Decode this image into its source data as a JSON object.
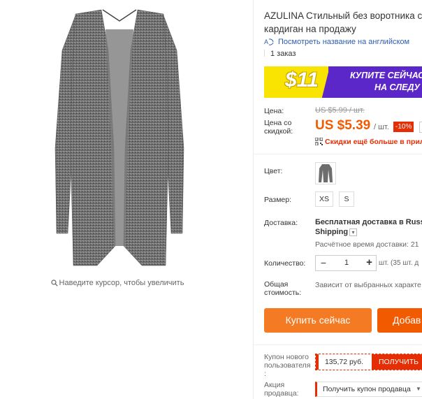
{
  "gallery": {
    "image_alt": "product-cardigan",
    "zoom_hint": "Наведите курсор, чтобы увеличить"
  },
  "product": {
    "title_line1": "AZULINA Стильный без воротника с д",
    "title_line2": "кардиган на продажу",
    "translate_link": "Посмотреть название на английском",
    "orders": "1 заказ"
  },
  "promo": {
    "price": "$11",
    "line1": "КУПИТЕ СЕЙЧАС",
    "line2": "НА СЛЕДУ"
  },
  "pricing": {
    "price_label": "Цена:",
    "old_price": "US $5.99 / шт.",
    "discount_price_label_line1": "Цена со",
    "discount_price_label_line2": "скидкой:",
    "new_price": "US $5.39",
    "unit": "/ шт.",
    "discount_badge": "-10%",
    "app_discount": "Скидки ещё больше в прило"
  },
  "options": {
    "color_label": "Цвет:",
    "size_label": "Размер:",
    "sizes": [
      "XS",
      "S"
    ]
  },
  "shipping": {
    "label": "Доставка:",
    "main": "Бесплатная доставка в Russia",
    "method": "Shipping",
    "estimate": "Расчётное время доставки: 21"
  },
  "quantity": {
    "label": "Количество:",
    "value": "1",
    "minus": "−",
    "plus": "+",
    "stock": "шт. (35 шт. д"
  },
  "total": {
    "label_line1": "Общая",
    "label_line2": "стоимость:",
    "note": "Зависит от выбранных характе"
  },
  "actions": {
    "buy_now": "Купить сейчас",
    "add_to_cart": "Добав"
  },
  "coupons": {
    "new_user_label_line1": "Купон нового",
    "new_user_label_line2": "пользователя",
    "new_user_label_line3": ":",
    "new_user_amount": "135,72 руб.",
    "get_button": "ПОЛУЧИТЬ",
    "seller_label_line1": "Акция",
    "seller_label_line2": "продавца:",
    "seller_button": "Получить купон продавца"
  },
  "colors": {
    "accent_orange": "#f47b23",
    "price_orange": "#f25a00",
    "sale_red": "#e62e04",
    "link_blue": "#2e5bb8",
    "promo_purple": "#5c27c8",
    "promo_yellow": "#f9e300"
  }
}
